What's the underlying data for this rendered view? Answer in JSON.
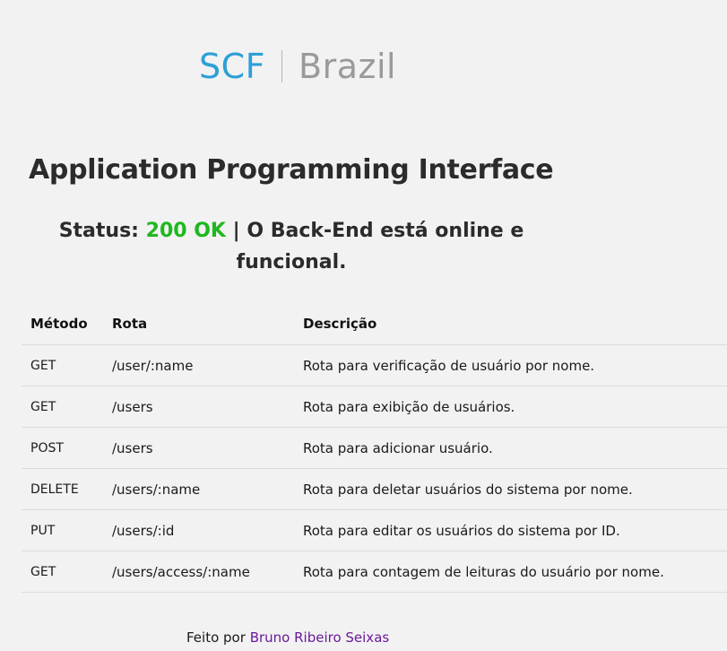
{
  "logo": {
    "scf": "SCF",
    "brazil": "Brazil"
  },
  "title": "Application Programming Interface",
  "status": {
    "label": "Status:",
    "code": "200 OK",
    "separator": "|",
    "message": "O Back-End está online e funcional.",
    "code_color": "#1fb81f"
  },
  "table": {
    "headers": {
      "method": "Método",
      "route": "Rota",
      "description": "Descrição"
    },
    "rows": [
      {
        "method": "GET",
        "route": "/user/:name",
        "description": "Rota para verificação de usuário por nome."
      },
      {
        "method": "GET",
        "route": "/users",
        "description": "Rota para exibição de usuários."
      },
      {
        "method": "POST",
        "route": "/users",
        "description": "Rota para adicionar usuário."
      },
      {
        "method": "DELETE",
        "route": "/users/:name",
        "description": "Rota para deletar usuários do sistema por nome."
      },
      {
        "method": "PUT",
        "route": "/users/:id",
        "description": "Rota para editar os usuários do sistema por ID."
      },
      {
        "method": "GET",
        "route": "/users/access/:name",
        "description": "Rota para contagem de leituras do usuário por nome."
      }
    ]
  },
  "footer": {
    "prefix": "Feito por",
    "author": "Bruno Ribeiro Seixas",
    "link_color": "#6a1b9a"
  },
  "colors": {
    "brand_blue": "#2f9fd6",
    "background": "#f2f2f2"
  }
}
